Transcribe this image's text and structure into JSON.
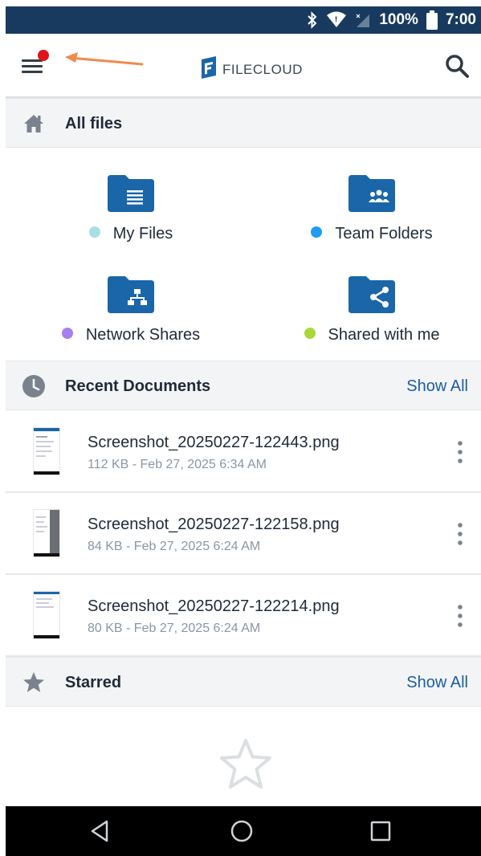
{
  "status_bar": {
    "battery": "100%",
    "time": "7:00",
    "icons": [
      "bluetooth-icon",
      "wifi-icon",
      "cell-signal-icon",
      "battery-icon"
    ]
  },
  "app_bar": {
    "logo_text": "FILECLOUD",
    "icons": [
      "menu-icon",
      "search-icon"
    ],
    "notification_badge_color": "#e0131a",
    "annotation_arrow_color": "#f08a4b"
  },
  "all_files": {
    "title": "All files",
    "icon": "home-icon",
    "tiles": [
      {
        "label": "My Files",
        "icon": "document-folder-icon",
        "dot_color": "#a6dfe6"
      },
      {
        "label": "Team Folders",
        "icon": "team-folder-icon",
        "dot_color": "#1f9bef"
      },
      {
        "label": "Network Shares",
        "icon": "network-folder-icon",
        "dot_color": "#a77ff0"
      },
      {
        "label": "Shared with me",
        "icon": "shared-folder-icon",
        "dot_color": "#a8d838"
      }
    ]
  },
  "recent": {
    "title": "Recent Documents",
    "show_all": "Show All",
    "icon": "clock-icon",
    "items": [
      {
        "name": "Screenshot_20250227-122443.png",
        "meta": "112 KB - Feb 27, 2025 6:34 AM"
      },
      {
        "name": "Screenshot_20250227-122158.png",
        "meta": "84 KB - Feb 27, 2025 6:24 AM"
      },
      {
        "name": "Screenshot_20250227-122214.png",
        "meta": "80 KB - Feb 27, 2025 6:24 AM"
      }
    ]
  },
  "starred": {
    "title": "Starred",
    "show_all": "Show All",
    "icon": "star-icon"
  },
  "colors": {
    "brand_dark": "#173a5e",
    "folder_blue": "#1a66a8",
    "link_blue": "#1a5e9e"
  },
  "nav_bar": {
    "icons": [
      "back-icon",
      "home-circle-icon",
      "recents-icon"
    ]
  }
}
